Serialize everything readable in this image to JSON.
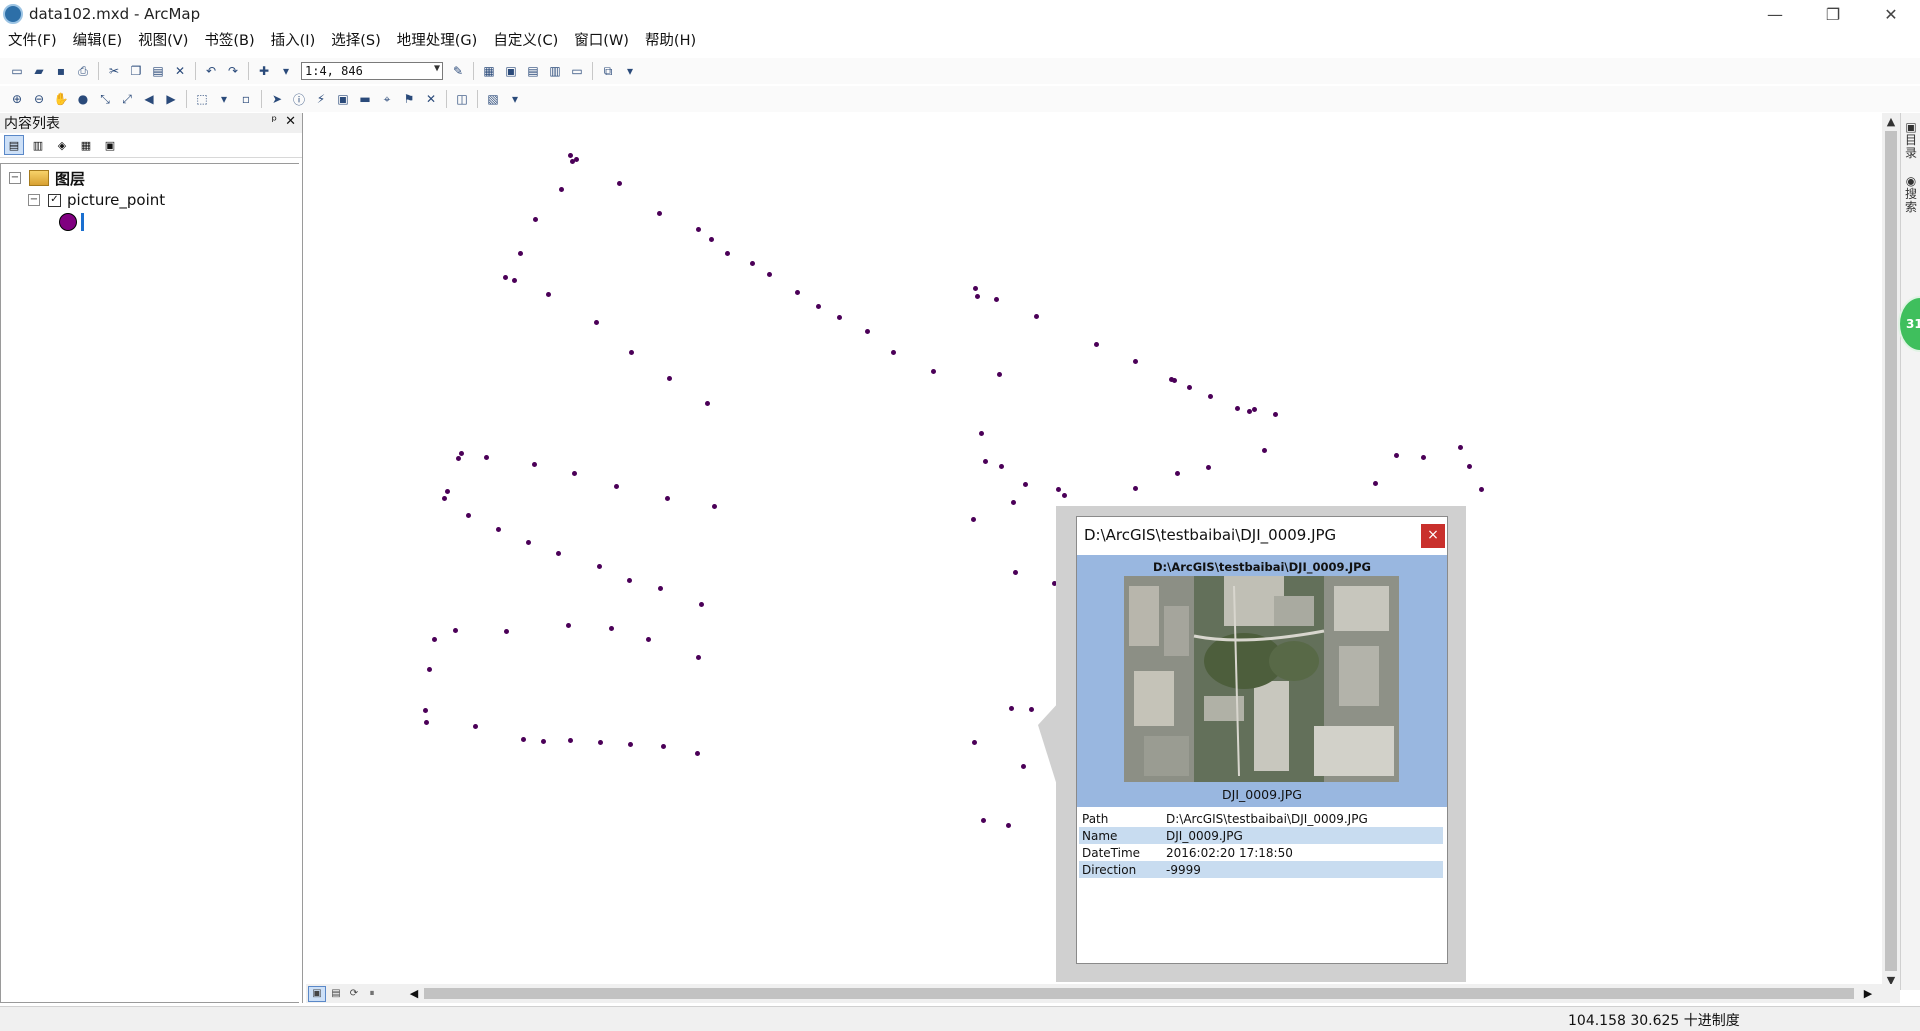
{
  "window": {
    "title": "data102.mxd - ArcMap",
    "controls": [
      "—",
      "❐",
      "✕"
    ]
  },
  "menu": [
    "文件(F)",
    "编辑(E)",
    "视图(V)",
    "书签(B)",
    "插入(I)",
    "选择(S)",
    "地理处理(G)",
    "自定义(C)",
    "窗口(W)",
    "帮助(H)"
  ],
  "toolbar": {
    "scale_value": "1:4, 846"
  },
  "toc": {
    "title": "内容列表",
    "pin": "ᵖ",
    "close": "✕",
    "root_label": "图层",
    "layer_label": "picture_point",
    "layer_checked": "✓",
    "expander_root": "−",
    "expander_layer": "−",
    "symbol_color": "#800080"
  },
  "side_tabs": [
    "目录",
    "搜索"
  ],
  "green_badge": "31",
  "popup": {
    "title": "D:\\ArcGIS\\testbaibai\\DJI_0009.JPG",
    "close_label": "×",
    "header_path": "D:\\ArcGIS\\testbaibai\\DJI_0009.JPG",
    "caption": "DJI_0009.JPG",
    "attributes": [
      {
        "key": "Path",
        "value": "D:\\ArcGIS\\testbaibai\\DJI_0009.JPG"
      },
      {
        "key": "Name",
        "value": "DJI_0009.JPG"
      },
      {
        "key": "DateTime",
        "value": "2016:02:20 17:18:50"
      },
      {
        "key": "Direction",
        "value": "-9999"
      }
    ]
  },
  "status": {
    "coords": "104.158  30.625 十进制度"
  },
  "colors": {
    "point": "#4b0058",
    "popup_blue": "#99b7e0",
    "close_red": "#c9302c"
  }
}
